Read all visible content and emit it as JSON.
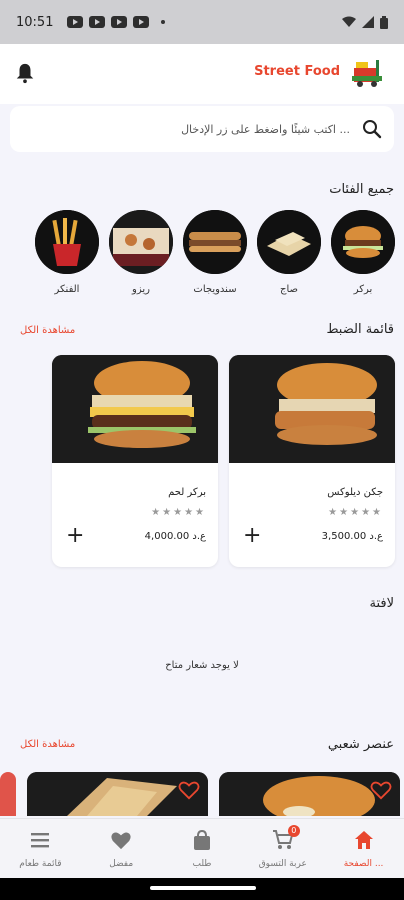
{
  "status_bar": {
    "time": "10:51"
  },
  "header": {
    "brand": "Street Food"
  },
  "search": {
    "placeholder": "اكتب شيئًا واضغط على زر الإدخال ..."
  },
  "categories": {
    "title": "جميع الفئات",
    "items": [
      {
        "label": "بركر"
      },
      {
        "label": "صاج"
      },
      {
        "label": "سندويجات"
      },
      {
        "label": "ريزو"
      },
      {
        "label": "الفنكر"
      }
    ]
  },
  "menu_list": {
    "title": "قائمة الضبط",
    "see_all": "مشاهدة الكل",
    "items": [
      {
        "name": "جكن ديلوكس",
        "stars": "★★★★★",
        "price": "3,500.00 ع.د"
      },
      {
        "name": "بركر لحم",
        "stars": "★★★★★",
        "price": "4,000.00 ع.د"
      }
    ]
  },
  "banner": {
    "title": "لافتة",
    "empty": "لا يوجد شعار متاح"
  },
  "popular": {
    "title": "عنصر شعبي",
    "see_all": "مشاهدة الكل"
  },
  "nav": {
    "items": [
      {
        "label": "الصفحة ..."
      },
      {
        "label": "عربة التسوق",
        "badge": "0"
      },
      {
        "label": "طلب"
      },
      {
        "label": "مفضل"
      },
      {
        "label": "قائمة طعام"
      }
    ]
  },
  "colors": {
    "accent": "#e8472f"
  }
}
